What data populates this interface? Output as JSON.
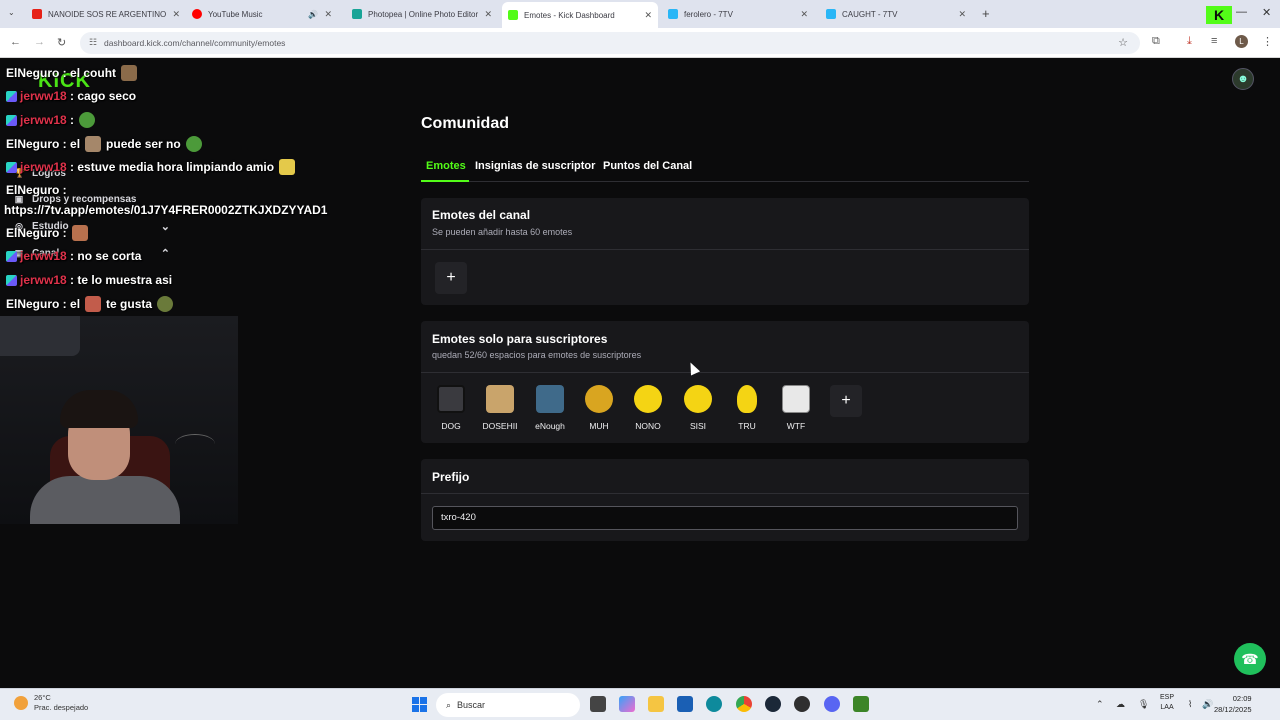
{
  "browser": {
    "tabs": [
      {
        "title": "NANOIDE SOS RE ARGENTINO",
        "favicon_color": "#e62117"
      },
      {
        "title": "YouTube Music",
        "favicon_color": "#ff0000"
      },
      {
        "title": "Photopea | Online Photo Editor",
        "favicon_color": "#18a497"
      },
      {
        "title": "Emotes - Kick Dashboard",
        "favicon_color": "#53fc18"
      },
      {
        "title": "ferolero - 7TV",
        "favicon_color": "#29b6f6"
      },
      {
        "title": "CAUGHT - 7TV",
        "favicon_color": "#29b6f6"
      }
    ],
    "active_tab": 3,
    "url": "dashboard.kick.com/channel/community/emotes",
    "profile_initial": "L"
  },
  "stream_overlay": {
    "logo_text": "KICK",
    "sidebar_items": [
      {
        "label": "Logros",
        "icon": "trophy-icon"
      },
      {
        "label": "Drops y recompensas",
        "icon": "gift-icon"
      },
      {
        "label": "Estudio",
        "icon": "studio-icon"
      },
      {
        "label": "Canal",
        "icon": "channel-icon"
      }
    ],
    "chat": [
      {
        "user": "ElNeguro",
        "user_color": "#ffffff",
        "text": "el couht",
        "emote_after": true
      },
      {
        "user": "jerww18",
        "user_color": "#e0324b",
        "text": "cago seco",
        "badge": true
      },
      {
        "user": "jerww18",
        "user_color": "#e0324b",
        "text": "",
        "badge": true,
        "emote_after": true
      },
      {
        "user": "ElNeguro",
        "user_color": "#ffffff",
        "text": "el",
        "text2": "puede ser no"
      },
      {
        "user": "jerww18",
        "user_color": "#e0324b",
        "text": "estuve media hora limpiando amio",
        "badge": true,
        "emote_after": true
      },
      {
        "user": "ElNeguro",
        "user_color": "#ffffff",
        "text": ""
      },
      {
        "user": "",
        "user_color": "#ffffff",
        "text": "https://7tv.app/emotes/01J7Y4FRER0002ZTKJXDZYYAD1"
      },
      {
        "user": "ElNeguro",
        "user_color": "#ffffff",
        "text": "",
        "emote_after": true
      },
      {
        "user": "jerww18",
        "user_color": "#e0324b",
        "text": "no se corta",
        "badge": true
      },
      {
        "user": "jerww18",
        "user_color": "#e0324b",
        "text": "te lo muestra asi",
        "badge": true
      },
      {
        "user": "ElNeguro",
        "user_color": "#ffffff",
        "text": "el",
        "text2": "te gusta"
      }
    ]
  },
  "page": {
    "title": "Comunidad",
    "tabs": [
      "Emotes",
      "Insignias de suscriptor",
      "Puntos del Canal"
    ],
    "active_tab": 0,
    "channel_emotes": {
      "title": "Emotes del canal",
      "subtitle": "Se pueden añadir hasta 60 emotes",
      "add_label": "+"
    },
    "sub_emotes": {
      "title": "Emotes solo para suscriptores",
      "subtitle": "quedan 52/60 espacios para emotes de suscriptores",
      "add_label": "+",
      "emotes": [
        {
          "name": "DOG",
          "color": "#3a3a3f"
        },
        {
          "name": "DOSEHII",
          "color": "#c9a46b"
        },
        {
          "name": "eNough",
          "color": "#3f6a8a"
        },
        {
          "name": "MUH",
          "color": "#d9a520"
        },
        {
          "name": "NONO",
          "color": "#f4d414"
        },
        {
          "name": "SISI",
          "color": "#f4d414"
        },
        {
          "name": "TRU",
          "color": "#f4d414"
        },
        {
          "name": "WTF",
          "color": "#e8e8e8"
        }
      ]
    },
    "prefix": {
      "title": "Prefijo",
      "value": "txro-420"
    }
  },
  "taskbar": {
    "weather_temp": "26°C",
    "weather_desc": "Prac. despejado",
    "search_placeholder": "Buscar",
    "lang_line1": "ESP",
    "lang_line2": "LAA",
    "time": "02:09",
    "date": "28/12/2025"
  },
  "colors": {
    "accent": "#53fc18",
    "card_bg": "#18181b",
    "page_bg": "#0b0b0c"
  }
}
